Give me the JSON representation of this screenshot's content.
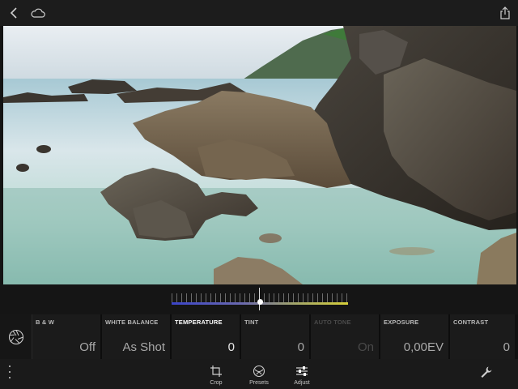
{
  "topbar": {
    "back_icon": "chevron-left-icon",
    "cloud_icon": "cloud-icon",
    "share_icon": "share-icon"
  },
  "photo": {
    "description_icon": "landscape-photo"
  },
  "slider": {
    "active_tool": "TEMPERATURE",
    "position_fraction": 0.5,
    "gradient_start": "#3b44c8",
    "gradient_end": "#d6cf3a"
  },
  "tools": [
    {
      "label": "B & W",
      "value": "Off",
      "state": "normal"
    },
    {
      "label": "WHITE BALANCE",
      "value": "As Shot",
      "state": "normal"
    },
    {
      "label": "TEMPERATURE",
      "value": "0",
      "state": "active"
    },
    {
      "label": "TINT",
      "value": "0",
      "state": "normal"
    },
    {
      "label": "AUTO TONE",
      "value": "On",
      "state": "disabled"
    },
    {
      "label": "EXPOSURE",
      "value": "0,00EV",
      "state": "normal"
    },
    {
      "label": "CONTRAST",
      "value": "0",
      "state": "normal"
    }
  ],
  "bottombar": {
    "crop_label": "Crop",
    "presets_label": "Presets",
    "adjust_label": "Adjust",
    "menu_icon": "more-vertical-icon",
    "settings_icon": "wrench-icon"
  }
}
